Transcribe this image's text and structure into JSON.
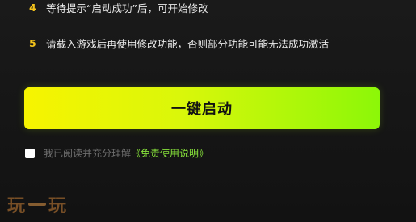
{
  "steps": [
    {
      "number": "4",
      "text": "等待提示“启动成功”后，可开始修改"
    },
    {
      "number": "5",
      "text": "请载入游戏后再使用修改功能，否则部分功能可能无法成功激活"
    }
  ],
  "launch_button": {
    "label": "一键启动"
  },
  "agreement": {
    "checked": false,
    "text": "我已阅读并充分理解",
    "link_text": "《免责使用说明》"
  },
  "watermark": {
    "text": "玩一玩"
  },
  "colors": {
    "background": "#141414",
    "step_number": "#f2c21b",
    "button_gradient_start": "#f7f400",
    "button_gradient_end": "#8cf708",
    "link": "#86e03a"
  }
}
